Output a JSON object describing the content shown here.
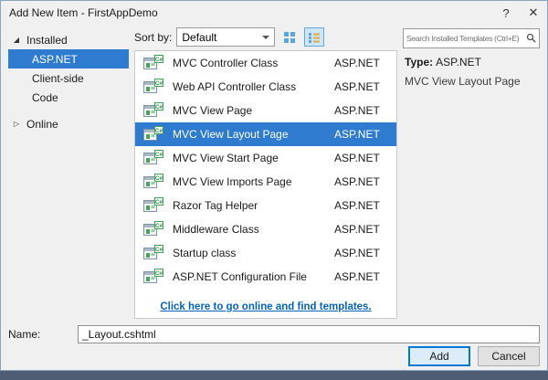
{
  "colors": {
    "selection": "#2e7bd0",
    "accent": "#0078d7",
    "link": "#0563c1",
    "background_edge": "#4e5d73"
  },
  "icons": {
    "csharp_badge": "C#"
  },
  "window": {
    "title": "Add New Item - FirstAppDemo",
    "help_icon": "?",
    "close_icon": "✕"
  },
  "sidebar": {
    "installed": {
      "label": "Installed",
      "expander": "◢"
    },
    "installed_items": [
      {
        "label": "ASP.NET",
        "selected": true
      },
      {
        "label": "Client-side",
        "selected": false
      },
      {
        "label": "Code",
        "selected": false
      }
    ],
    "online": {
      "label": "Online",
      "expander": "▷"
    }
  },
  "toolbar": {
    "sort_label": "Sort by:",
    "sort_value": "Default"
  },
  "search": {
    "placeholder": "Search Installed Templates (Ctrl+E)"
  },
  "templates": [
    {
      "name": "MVC Controller Class",
      "category": "ASP.NET",
      "selected": false
    },
    {
      "name": "Web API Controller Class",
      "category": "ASP.NET",
      "selected": false
    },
    {
      "name": "MVC View Page",
      "category": "ASP.NET",
      "selected": false
    },
    {
      "name": "MVC View Layout Page",
      "category": "ASP.NET",
      "selected": true
    },
    {
      "name": "MVC View Start Page",
      "category": "ASP.NET",
      "selected": false
    },
    {
      "name": "MVC View Imports Page",
      "category": "ASP.NET",
      "selected": false
    },
    {
      "name": "Razor Tag Helper",
      "category": "ASP.NET",
      "selected": false
    },
    {
      "name": "Middleware Class",
      "category": "ASP.NET",
      "selected": false
    },
    {
      "name": "Startup class",
      "category": "ASP.NET",
      "selected": false
    },
    {
      "name": "ASP.NET Configuration File",
      "category": "ASP.NET",
      "selected": false
    }
  ],
  "list_footer": {
    "online_link": "Click here to go online and find templates."
  },
  "details": {
    "type_label": "Type:",
    "type_value": "ASP.NET",
    "description": "MVC View Layout Page"
  },
  "footer": {
    "name_label": "Name:",
    "name_value": "_Layout.cshtml",
    "add_label": "Add",
    "cancel_label": "Cancel"
  }
}
